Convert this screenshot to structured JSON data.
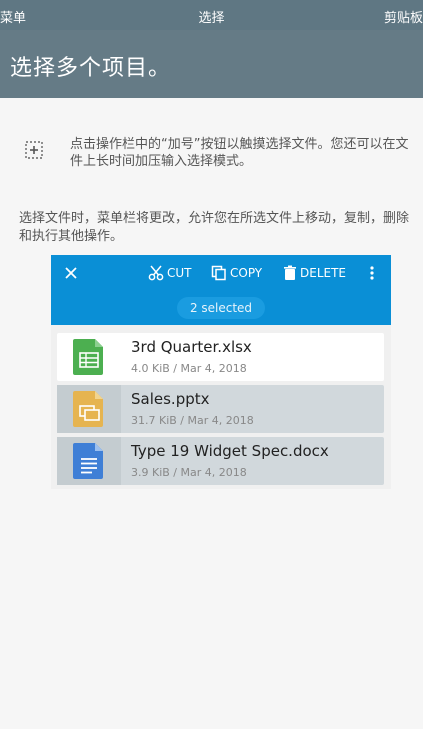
{
  "statusbar": {
    "left": "菜单",
    "center": "选择",
    "right": "剪贴板"
  },
  "header": {
    "title": "选择多个项目。"
  },
  "tip": {
    "text": "点击操作栏中的“加号”按钮以触摸选择文件。您还可以在文件上长时间加压输入选择模式。",
    "icon": "select-plus-icon"
  },
  "paragraph": "选择文件时，菜单栏将更改，允许您在所选文件上移动，复制，删除和执行其他操作。",
  "demo": {
    "toolbar": {
      "cut_label": "CUT",
      "copy_label": "COPY",
      "delete_label": "DELETE",
      "selected_label": "2 selected"
    },
    "files": [
      {
        "name": "3rd Quarter.xlsx",
        "meta": "4.0 KiB / Mar 4, 2018",
        "icon": "spreadsheet-icon",
        "color": "#4caf50",
        "selected": false
      },
      {
        "name": "Sales.pptx",
        "meta": "31.7 KiB / Mar 4, 2018",
        "icon": "presentation-icon",
        "color": "#e6b450",
        "selected": true
      },
      {
        "name": "Type 19 Widget Spec.docx",
        "meta": "3.9 KiB / Mar 4, 2018",
        "icon": "document-icon",
        "color": "#3f7fd6",
        "selected": true
      }
    ]
  },
  "colors": {
    "header": "#657b86",
    "toolbar": "#0a8fd6",
    "selected_row": "#d1d8dc"
  }
}
